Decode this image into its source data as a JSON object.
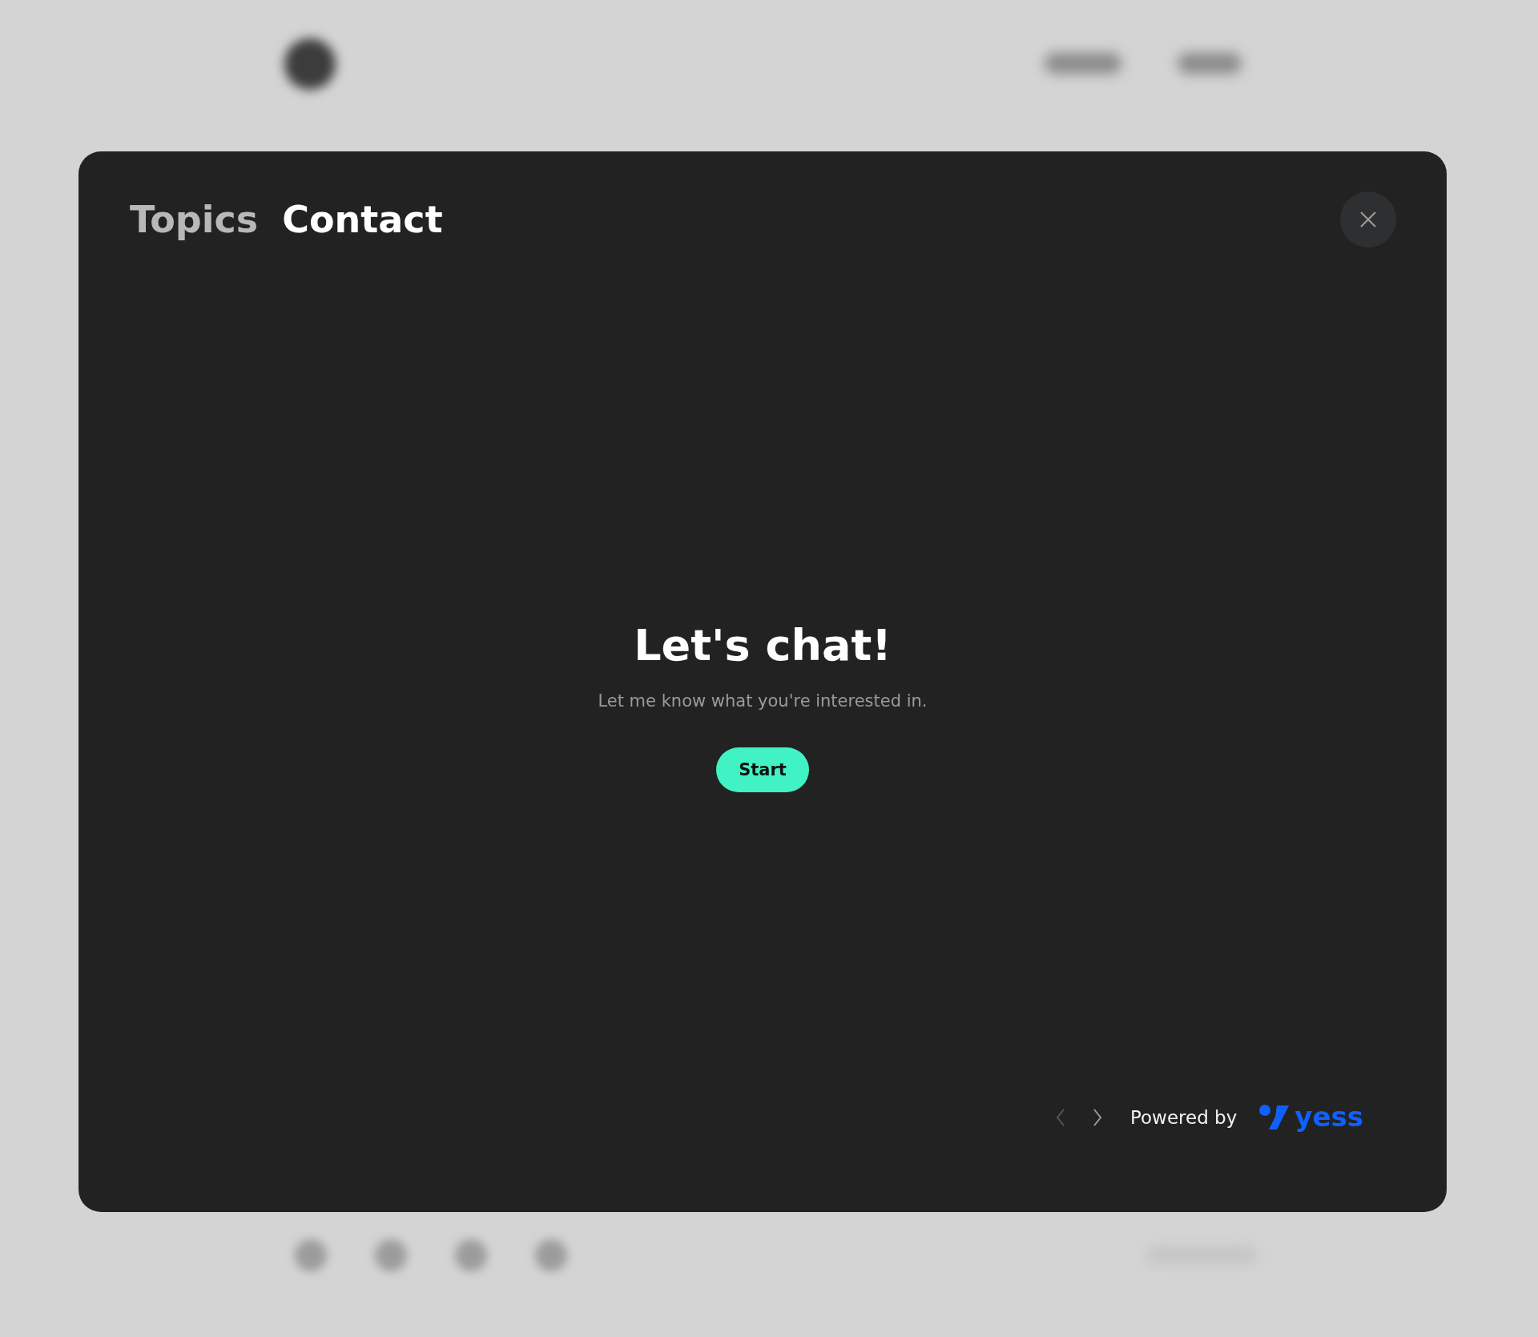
{
  "modal": {
    "tabs": [
      {
        "label": "Topics",
        "selected": false
      },
      {
        "label": "Contact",
        "selected": true
      }
    ],
    "title": "Let's chat!",
    "subtitle": "Let me know what you're interested in.",
    "start_button": "Start",
    "footer": {
      "nav": [
        {
          "kind": "prev",
          "disabled": true
        },
        {
          "kind": "next",
          "disabled": false
        }
      ],
      "powered_by": "Powered by",
      "brand": "yess"
    }
  }
}
